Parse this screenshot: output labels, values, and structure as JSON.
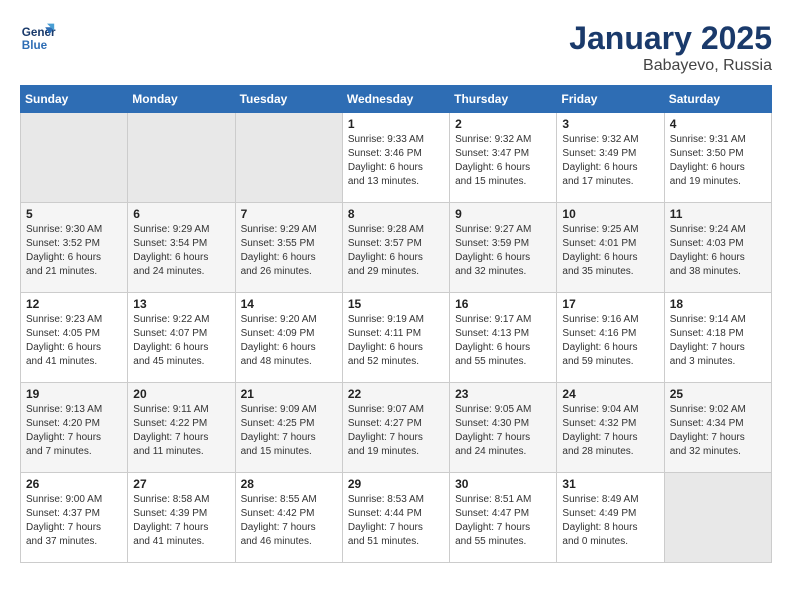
{
  "logo": {
    "line1": "General",
    "line2": "Blue"
  },
  "title": "January 2025",
  "subtitle": "Babayevo, Russia",
  "weekdays": [
    "Sunday",
    "Monday",
    "Tuesday",
    "Wednesday",
    "Thursday",
    "Friday",
    "Saturday"
  ],
  "weeks": [
    [
      {
        "day": "",
        "info": ""
      },
      {
        "day": "",
        "info": ""
      },
      {
        "day": "",
        "info": ""
      },
      {
        "day": "1",
        "info": "Sunrise: 9:33 AM\nSunset: 3:46 PM\nDaylight: 6 hours\nand 13 minutes."
      },
      {
        "day": "2",
        "info": "Sunrise: 9:32 AM\nSunset: 3:47 PM\nDaylight: 6 hours\nand 15 minutes."
      },
      {
        "day": "3",
        "info": "Sunrise: 9:32 AM\nSunset: 3:49 PM\nDaylight: 6 hours\nand 17 minutes."
      },
      {
        "day": "4",
        "info": "Sunrise: 9:31 AM\nSunset: 3:50 PM\nDaylight: 6 hours\nand 19 minutes."
      }
    ],
    [
      {
        "day": "5",
        "info": "Sunrise: 9:30 AM\nSunset: 3:52 PM\nDaylight: 6 hours\nand 21 minutes."
      },
      {
        "day": "6",
        "info": "Sunrise: 9:29 AM\nSunset: 3:54 PM\nDaylight: 6 hours\nand 24 minutes."
      },
      {
        "day": "7",
        "info": "Sunrise: 9:29 AM\nSunset: 3:55 PM\nDaylight: 6 hours\nand 26 minutes."
      },
      {
        "day": "8",
        "info": "Sunrise: 9:28 AM\nSunset: 3:57 PM\nDaylight: 6 hours\nand 29 minutes."
      },
      {
        "day": "9",
        "info": "Sunrise: 9:27 AM\nSunset: 3:59 PM\nDaylight: 6 hours\nand 32 minutes."
      },
      {
        "day": "10",
        "info": "Sunrise: 9:25 AM\nSunset: 4:01 PM\nDaylight: 6 hours\nand 35 minutes."
      },
      {
        "day": "11",
        "info": "Sunrise: 9:24 AM\nSunset: 4:03 PM\nDaylight: 6 hours\nand 38 minutes."
      }
    ],
    [
      {
        "day": "12",
        "info": "Sunrise: 9:23 AM\nSunset: 4:05 PM\nDaylight: 6 hours\nand 41 minutes."
      },
      {
        "day": "13",
        "info": "Sunrise: 9:22 AM\nSunset: 4:07 PM\nDaylight: 6 hours\nand 45 minutes."
      },
      {
        "day": "14",
        "info": "Sunrise: 9:20 AM\nSunset: 4:09 PM\nDaylight: 6 hours\nand 48 minutes."
      },
      {
        "day": "15",
        "info": "Sunrise: 9:19 AM\nSunset: 4:11 PM\nDaylight: 6 hours\nand 52 minutes."
      },
      {
        "day": "16",
        "info": "Sunrise: 9:17 AM\nSunset: 4:13 PM\nDaylight: 6 hours\nand 55 minutes."
      },
      {
        "day": "17",
        "info": "Sunrise: 9:16 AM\nSunset: 4:16 PM\nDaylight: 6 hours\nand 59 minutes."
      },
      {
        "day": "18",
        "info": "Sunrise: 9:14 AM\nSunset: 4:18 PM\nDaylight: 7 hours\nand 3 minutes."
      }
    ],
    [
      {
        "day": "19",
        "info": "Sunrise: 9:13 AM\nSunset: 4:20 PM\nDaylight: 7 hours\nand 7 minutes."
      },
      {
        "day": "20",
        "info": "Sunrise: 9:11 AM\nSunset: 4:22 PM\nDaylight: 7 hours\nand 11 minutes."
      },
      {
        "day": "21",
        "info": "Sunrise: 9:09 AM\nSunset: 4:25 PM\nDaylight: 7 hours\nand 15 minutes."
      },
      {
        "day": "22",
        "info": "Sunrise: 9:07 AM\nSunset: 4:27 PM\nDaylight: 7 hours\nand 19 minutes."
      },
      {
        "day": "23",
        "info": "Sunrise: 9:05 AM\nSunset: 4:30 PM\nDaylight: 7 hours\nand 24 minutes."
      },
      {
        "day": "24",
        "info": "Sunrise: 9:04 AM\nSunset: 4:32 PM\nDaylight: 7 hours\nand 28 minutes."
      },
      {
        "day": "25",
        "info": "Sunrise: 9:02 AM\nSunset: 4:34 PM\nDaylight: 7 hours\nand 32 minutes."
      }
    ],
    [
      {
        "day": "26",
        "info": "Sunrise: 9:00 AM\nSunset: 4:37 PM\nDaylight: 7 hours\nand 37 minutes."
      },
      {
        "day": "27",
        "info": "Sunrise: 8:58 AM\nSunset: 4:39 PM\nDaylight: 7 hours\nand 41 minutes."
      },
      {
        "day": "28",
        "info": "Sunrise: 8:55 AM\nSunset: 4:42 PM\nDaylight: 7 hours\nand 46 minutes."
      },
      {
        "day": "29",
        "info": "Sunrise: 8:53 AM\nSunset: 4:44 PM\nDaylight: 7 hours\nand 51 minutes."
      },
      {
        "day": "30",
        "info": "Sunrise: 8:51 AM\nSunset: 4:47 PM\nDaylight: 7 hours\nand 55 minutes."
      },
      {
        "day": "31",
        "info": "Sunrise: 8:49 AM\nSunset: 4:49 PM\nDaylight: 8 hours\nand 0 minutes."
      },
      {
        "day": "",
        "info": ""
      }
    ]
  ]
}
